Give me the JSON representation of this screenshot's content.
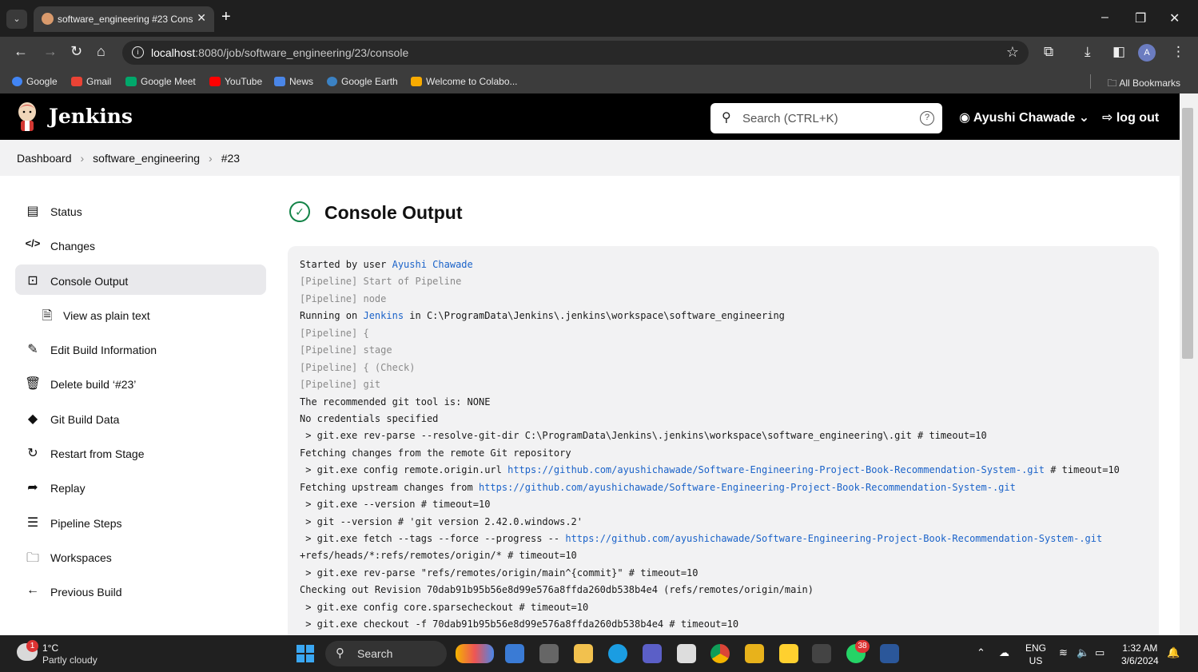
{
  "browser": {
    "tab_title": "software_engineering #23 Cons",
    "url_host": "localhost",
    "url_rest": ":8080/job/software_engineering/23/console",
    "bookmarks": [
      "Google",
      "Gmail",
      "Google Meet",
      "YouTube",
      "News",
      "Google Earth",
      "Welcome to Colabo..."
    ],
    "all_bookmarks": "All Bookmarks",
    "profile_initial": "A"
  },
  "jenkins": {
    "title": "Jenkins",
    "search_placeholder": "Search (CTRL+K)",
    "user": "Ayushi Chawade",
    "logout": "log out"
  },
  "breadcrumb": [
    "Dashboard",
    "software_engineering",
    "#23"
  ],
  "sidebar": {
    "items": [
      {
        "label": "Status",
        "icon": "document-icon"
      },
      {
        "label": "Changes",
        "icon": "code-icon"
      },
      {
        "label": "Console Output",
        "icon": "terminal-icon"
      },
      {
        "label": "View as plain text",
        "icon": "file-icon"
      },
      {
        "label": "Edit Build Information",
        "icon": "edit-icon"
      },
      {
        "label": "Delete build ‘#23’",
        "icon": "trash-icon"
      },
      {
        "label": "Git Build Data",
        "icon": "git-icon"
      },
      {
        "label": "Restart from Stage",
        "icon": "restart-icon"
      },
      {
        "label": "Replay",
        "icon": "replay-icon"
      },
      {
        "label": "Pipeline Steps",
        "icon": "list-icon"
      },
      {
        "label": "Workspaces",
        "icon": "folder-icon"
      },
      {
        "label": "Previous Build",
        "icon": "arrow-left-icon"
      }
    ]
  },
  "main": {
    "heading": "Console Output",
    "lines": [
      {
        "pre": "Started by user ",
        "link": "Ayushi Chawade",
        "post": "",
        "dim": false
      },
      {
        "pre": "[Pipeline] Start of Pipeline",
        "link": "",
        "post": "",
        "dim": true
      },
      {
        "pre": "[Pipeline] node",
        "link": "",
        "post": "",
        "dim": true
      },
      {
        "pre": "Running on ",
        "link": "Jenkins",
        "post": " in C:\\ProgramData\\Jenkins\\.jenkins\\workspace\\software_engineering",
        "dim": false
      },
      {
        "pre": "[Pipeline] {",
        "link": "",
        "post": "",
        "dim": true
      },
      {
        "pre": "[Pipeline] stage",
        "link": "",
        "post": "",
        "dim": true
      },
      {
        "pre": "[Pipeline] { (Check)",
        "link": "",
        "post": "",
        "dim": true
      },
      {
        "pre": "[Pipeline] git",
        "link": "",
        "post": "",
        "dim": true
      },
      {
        "pre": "The recommended git tool is: NONE",
        "link": "",
        "post": "",
        "dim": false
      },
      {
        "pre": "No credentials specified",
        "link": "",
        "post": "",
        "dim": false
      },
      {
        "pre": " > git.exe rev-parse --resolve-git-dir C:\\ProgramData\\Jenkins\\.jenkins\\workspace\\software_engineering\\.git # timeout=10",
        "link": "",
        "post": "",
        "dim": false
      },
      {
        "pre": "Fetching changes from the remote Git repository",
        "link": "",
        "post": "",
        "dim": false
      },
      {
        "pre": " > git.exe config remote.origin.url ",
        "link": "https://github.com/ayushichawade/Software-Engineering-Project-Book-Recommendation-System-.git",
        "post": " # timeout=10",
        "dim": false
      },
      {
        "pre": "Fetching upstream changes from ",
        "link": "https://github.com/ayushichawade/Software-Engineering-Project-Book-Recommendation-System-.git",
        "post": "",
        "dim": false
      },
      {
        "pre": " > git.exe --version # timeout=10",
        "link": "",
        "post": "",
        "dim": false
      },
      {
        "pre": " > git --version # 'git version 2.42.0.windows.2'",
        "link": "",
        "post": "",
        "dim": false
      },
      {
        "pre": " > git.exe fetch --tags --force --progress -- ",
        "link": "https://github.com/ayushichawade/Software-Engineering-Project-Book-Recommendation-System-.git",
        "post": "",
        "dim": false
      },
      {
        "pre": "+refs/heads/*:refs/remotes/origin/* # timeout=10",
        "link": "",
        "post": "",
        "dim": false
      },
      {
        "pre": " > git.exe rev-parse \"refs/remotes/origin/main^{commit}\" # timeout=10",
        "link": "",
        "post": "",
        "dim": false
      },
      {
        "pre": "Checking out Revision 70dab91b95b56e8d99e576a8ffda260db538b4e4 (refs/remotes/origin/main)",
        "link": "",
        "post": "",
        "dim": false
      },
      {
        "pre": " > git.exe config core.sparsecheckout # timeout=10",
        "link": "",
        "post": "",
        "dim": false
      },
      {
        "pre": " > git.exe checkout -f 70dab91b95b56e8d99e576a8ffda260db538b4e4 # timeout=10",
        "link": "",
        "post": "",
        "dim": false
      }
    ]
  },
  "taskbar": {
    "temp": "1°C",
    "condition": "Partly cloudy",
    "weather_badge": "1",
    "search": "Search",
    "whatsapp_badge": "38",
    "lang_top": "ENG",
    "lang_bottom": "US",
    "time": "1:32 AM",
    "date": "3/6/2024"
  }
}
